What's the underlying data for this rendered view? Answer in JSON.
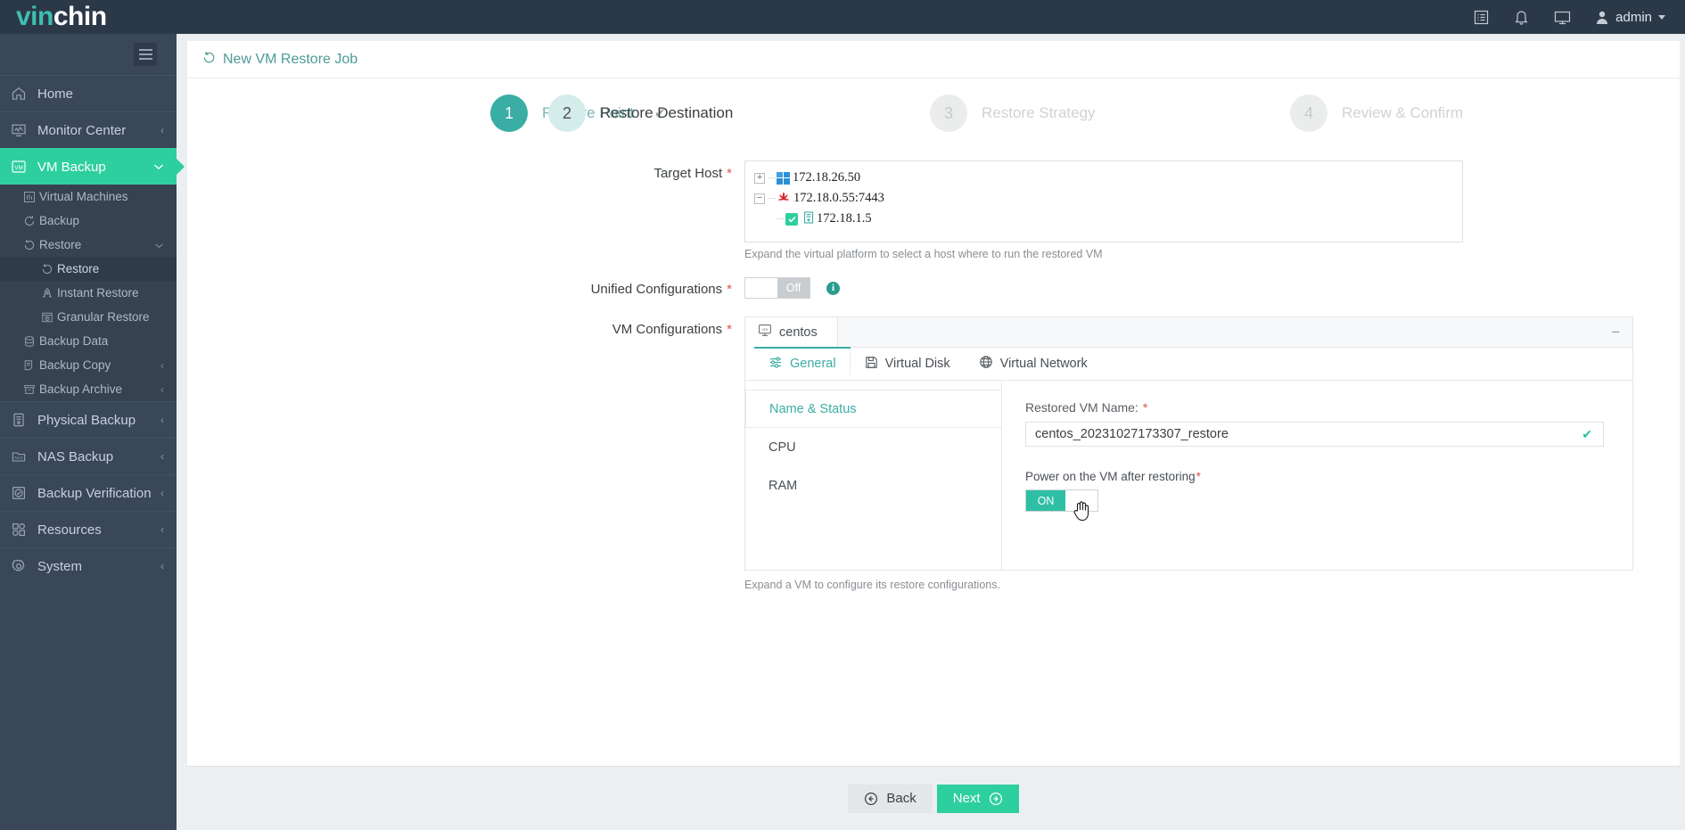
{
  "brand": {
    "part1": "vin",
    "part2": "chin"
  },
  "topbar": {
    "icons": [
      "list-icon",
      "bell-icon",
      "monitor-icon"
    ],
    "user": "admin"
  },
  "sidebar": {
    "items": [
      {
        "label": "Home",
        "icon": "home-icon",
        "chevron": ""
      },
      {
        "label": "Monitor Center",
        "icon": "monitor-chart-icon",
        "chevron": "‹"
      },
      {
        "label": "VM Backup",
        "icon": "vm-icon",
        "chevron": "∨",
        "active": true
      }
    ],
    "sub_items": [
      {
        "label": "Virtual Machines",
        "icon": "chart-bars-icon",
        "level": 1
      },
      {
        "label": "Backup",
        "icon": "refresh-icon",
        "level": 1
      },
      {
        "label": "Restore",
        "icon": "restore-icon",
        "level": 1,
        "chevron": "∨"
      },
      {
        "label": "Restore",
        "icon": "restore-icon",
        "level": 2,
        "selected": true
      },
      {
        "label": "Instant Restore",
        "icon": "rocket-icon",
        "level": 2
      },
      {
        "label": "Granular Restore",
        "icon": "granular-icon",
        "level": 2
      },
      {
        "label": "Backup Data",
        "icon": "database-icon",
        "level": 1
      },
      {
        "label": "Backup Copy",
        "icon": "copy-icon",
        "level": 1,
        "chevron": "‹"
      },
      {
        "label": "Backup Archive",
        "icon": "archive-icon",
        "level": 1,
        "chevron": "‹"
      }
    ],
    "items_bottom": [
      {
        "label": "Physical Backup",
        "icon": "server-icon",
        "chevron": "‹"
      },
      {
        "label": "NAS Backup",
        "icon": "nas-icon",
        "chevron": "‹"
      },
      {
        "label": "Backup Verification",
        "icon": "verify-shield-icon",
        "chevron": "‹"
      },
      {
        "label": "Resources",
        "icon": "grid-icon",
        "chevron": "‹"
      },
      {
        "label": "System",
        "icon": "gear-icon",
        "chevron": "‹"
      }
    ]
  },
  "page": {
    "title": "New VM Restore Job",
    "title_icon": "restore-icon"
  },
  "stepper": {
    "steps": [
      {
        "num": "1",
        "label": "Restore Point",
        "state": "done",
        "tick": "✔"
      },
      {
        "num": "2",
        "label": "Restore Destination",
        "state": "current",
        "tick": ""
      },
      {
        "num": "3",
        "label": "Restore Strategy",
        "state": "todo",
        "tick": ""
      },
      {
        "num": "4",
        "label": "Review & Confirm",
        "state": "todo",
        "tick": ""
      }
    ]
  },
  "form": {
    "target_host": {
      "label": "Target Host",
      "required": "*",
      "hint": "Expand the virtual platform to select a host where to run the restored VM",
      "tree": [
        {
          "label": "172.18.26.50",
          "toggle": "+",
          "icon": "windows-icon",
          "level": 1
        },
        {
          "label": "172.18.0.55:7443",
          "toggle": "−",
          "icon": "huawei-icon",
          "level": 1
        },
        {
          "label": "172.18.1.5",
          "toggle": "",
          "icon": "host-icon",
          "level": 2,
          "checked": true
        }
      ]
    },
    "unified_configurations": {
      "label": "Unified Configurations",
      "required": "*",
      "state": "Off",
      "info_icon": "info-icon",
      "info_glyph": "i"
    },
    "vm_configurations": {
      "label": "VM Configurations",
      "required": "*",
      "hint": "Expand a VM to configure its restore configurations.",
      "vm_name": "centos",
      "vm_icon": "vm-monitor-icon",
      "collapse_glyph": "−",
      "tabs": [
        {
          "label": "General",
          "icon": "sliders-icon",
          "active": true
        },
        {
          "label": "Virtual Disk",
          "icon": "floppy-disk-icon",
          "active": false
        },
        {
          "label": "Virtual Network",
          "icon": "globe-icon",
          "active": false
        }
      ],
      "side_items": [
        {
          "label": "Name & Status",
          "active": true
        },
        {
          "label": "CPU",
          "active": false
        },
        {
          "label": "RAM",
          "active": false
        }
      ],
      "restored_vm_name": {
        "label": "Restored VM Name:",
        "required": "*",
        "value": "centos_20231027173307_restore",
        "valid_icon": "check-icon",
        "valid_glyph": "✔"
      },
      "power_on": {
        "label": "Power on the VM after restoring",
        "required": "*",
        "state": "ON"
      }
    }
  },
  "footer": {
    "back_label": "Back",
    "back_icon": "arrow-left-circle-icon",
    "next_label": "Next",
    "next_icon": "arrow-right-circle-icon"
  },
  "colors": {
    "accent": "#2ecf9e",
    "teal": "#3aada4",
    "sidebar": "#3a4759",
    "topbar": "#2b3848",
    "required": "#d9534f"
  }
}
